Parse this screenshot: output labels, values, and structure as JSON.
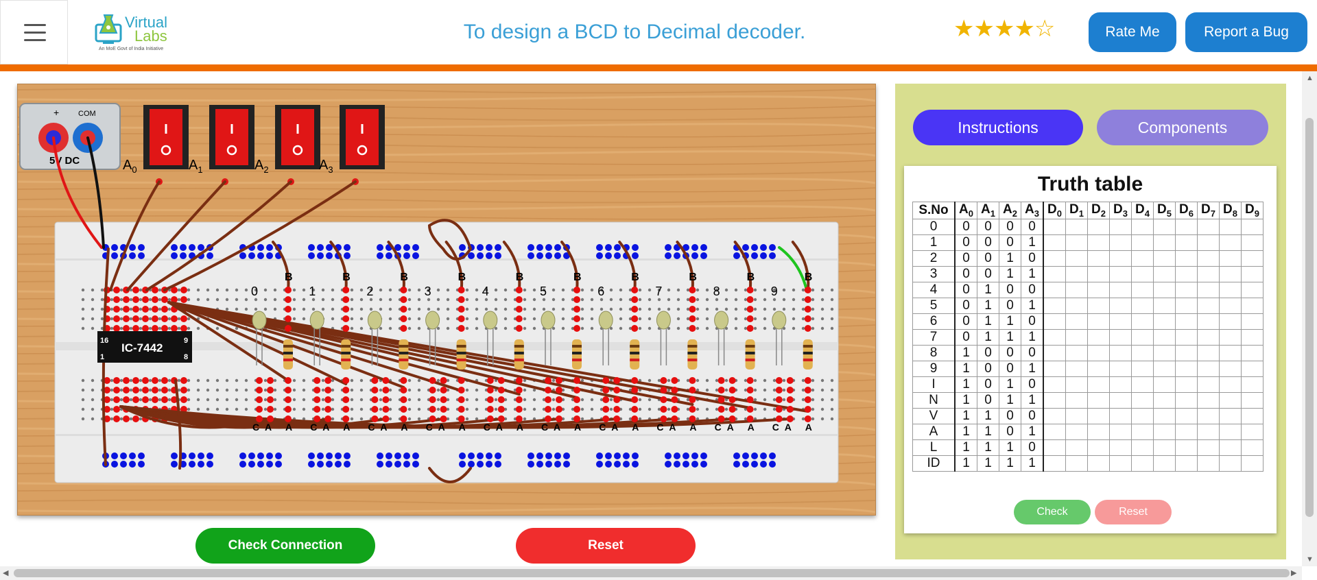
{
  "header": {
    "menu_icon": "hamburger-menu-icon",
    "logo_line1": "Virtual",
    "logo_line2": "Labs",
    "logo_tagline": "An MoE Govt of India Initiative",
    "title": "To design a BCD to Decimal decoder.",
    "rating": 4,
    "rating_max": 5,
    "stars_filled": "★★★★",
    "stars_empty": "☆",
    "rate_label": "Rate Me",
    "bug_label": "Report a Bug",
    "accent_color": "#ef6c00",
    "button_color": "#1d7fd0"
  },
  "workbench": {
    "power_plus": "+",
    "power_com": "COM",
    "power_label": "5V  DC",
    "switch_labels": [
      "A",
      "A",
      "A",
      "A"
    ],
    "switch_subs": [
      "0",
      "1",
      "2",
      "3"
    ],
    "ic_label": "IC-7442",
    "ic_pin_left_top": "16",
    "ic_pin_left_bot": "1",
    "ic_pin_right_top": "9",
    "ic_pin_right_bot": "8",
    "led_numbers": [
      "0",
      "1",
      "2",
      "3",
      "4",
      "5",
      "6",
      "7",
      "8",
      "9"
    ],
    "led_top_label": "B",
    "led_pin_labels": [
      "C",
      "A",
      "A"
    ],
    "check_connection_label": "Check Connection",
    "reset_label": "Reset"
  },
  "panel": {
    "tab_instructions": "Instructions",
    "tab_components": "Components",
    "truth_table_title": "Truth table",
    "headers": [
      "S.No",
      "A",
      "A",
      "A",
      "A",
      "D",
      "D",
      "D",
      "D",
      "D",
      "D",
      "D",
      "D",
      "D",
      "D"
    ],
    "header_subs": [
      "",
      "0",
      "1",
      "2",
      "3",
      "0",
      "1",
      "2",
      "3",
      "4",
      "5",
      "6",
      "7",
      "8",
      "9"
    ],
    "rows": [
      [
        "0",
        "0",
        "0",
        "0",
        "0"
      ],
      [
        "1",
        "0",
        "0",
        "0",
        "1"
      ],
      [
        "2",
        "0",
        "0",
        "1",
        "0"
      ],
      [
        "3",
        "0",
        "0",
        "1",
        "1"
      ],
      [
        "4",
        "0",
        "1",
        "0",
        "0"
      ],
      [
        "5",
        "0",
        "1",
        "0",
        "1"
      ],
      [
        "6",
        "0",
        "1",
        "1",
        "0"
      ],
      [
        "7",
        "0",
        "1",
        "1",
        "1"
      ],
      [
        "8",
        "1",
        "0",
        "0",
        "0"
      ],
      [
        "9",
        "1",
        "0",
        "0",
        "1"
      ],
      [
        "I",
        "1",
        "0",
        "1",
        "0"
      ],
      [
        "N",
        "1",
        "0",
        "1",
        "1"
      ],
      [
        "V",
        "1",
        "1",
        "0",
        "0"
      ],
      [
        "A",
        "1",
        "1",
        "0",
        "1"
      ],
      [
        "L",
        "1",
        "1",
        "1",
        "0"
      ],
      [
        "ID",
        "1",
        "1",
        "1",
        "1"
      ]
    ],
    "check_label": "Check",
    "reset_label": "Reset"
  }
}
